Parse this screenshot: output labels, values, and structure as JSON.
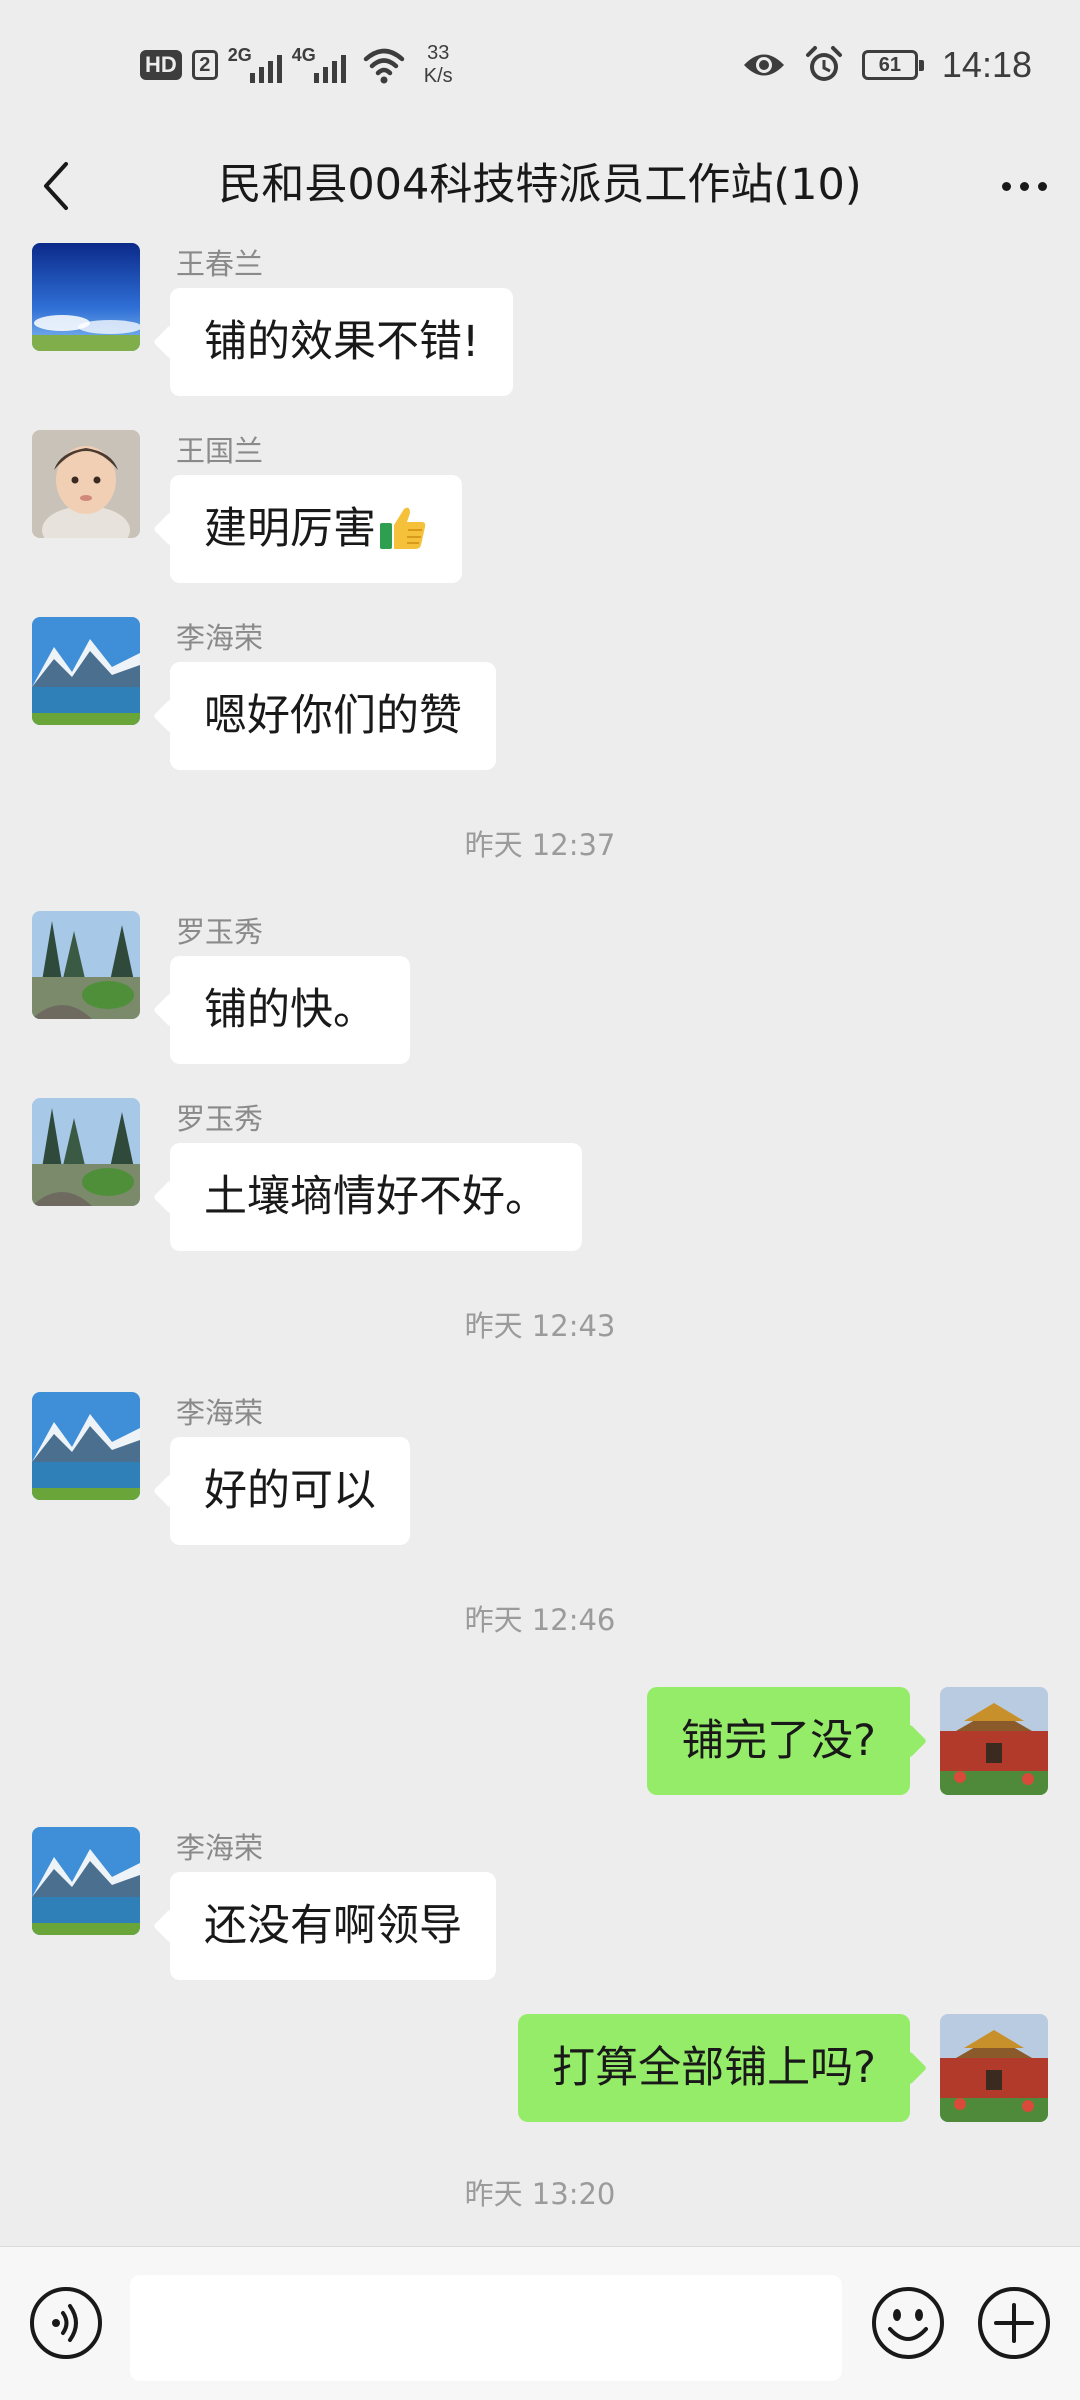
{
  "status_bar": {
    "hd": "HD",
    "sim": "2",
    "net1": "2G",
    "net2": "4G",
    "speed_value": "33",
    "speed_unit": "K/s",
    "battery": "61",
    "time": "14:18"
  },
  "header": {
    "title": "民和县004科技特派员工作站(10)"
  },
  "messages": [
    {
      "sender": "王春兰",
      "text": "铺的效果不错!"
    },
    {
      "sender": "王国兰",
      "text": "建明厉害"
    },
    {
      "sender": "李海荣",
      "text": "嗯好你们的赞"
    },
    {
      "time": "昨天 12:37"
    },
    {
      "sender": "罗玉秀",
      "text": "铺的快。"
    },
    {
      "sender": "罗玉秀",
      "text": "土壤墒情好不好。"
    },
    {
      "time": "昨天 12:43"
    },
    {
      "sender": "李海荣",
      "text": "好的可以"
    },
    {
      "time": "昨天 12:46"
    },
    {
      "text": "铺完了没?"
    },
    {
      "sender": "李海荣",
      "text": "还没有啊领导"
    },
    {
      "text": "打算全部铺上吗?"
    },
    {
      "time": "昨天 13:20"
    }
  ],
  "input": {
    "value": ""
  },
  "icons": {
    "back": "chevron-left-icon",
    "more": "more-dots-icon",
    "voice": "voice-icon",
    "emoji": "emoji-icon",
    "plus": "plus-icon",
    "thumbs_up": "thumbs-up-emoji"
  },
  "colors": {
    "background": "#ededed",
    "bubble_in": "#ffffff",
    "bubble_out": "#95ec69",
    "sender_name": "#8a8a8a",
    "timestamp": "#9b9b9b"
  }
}
